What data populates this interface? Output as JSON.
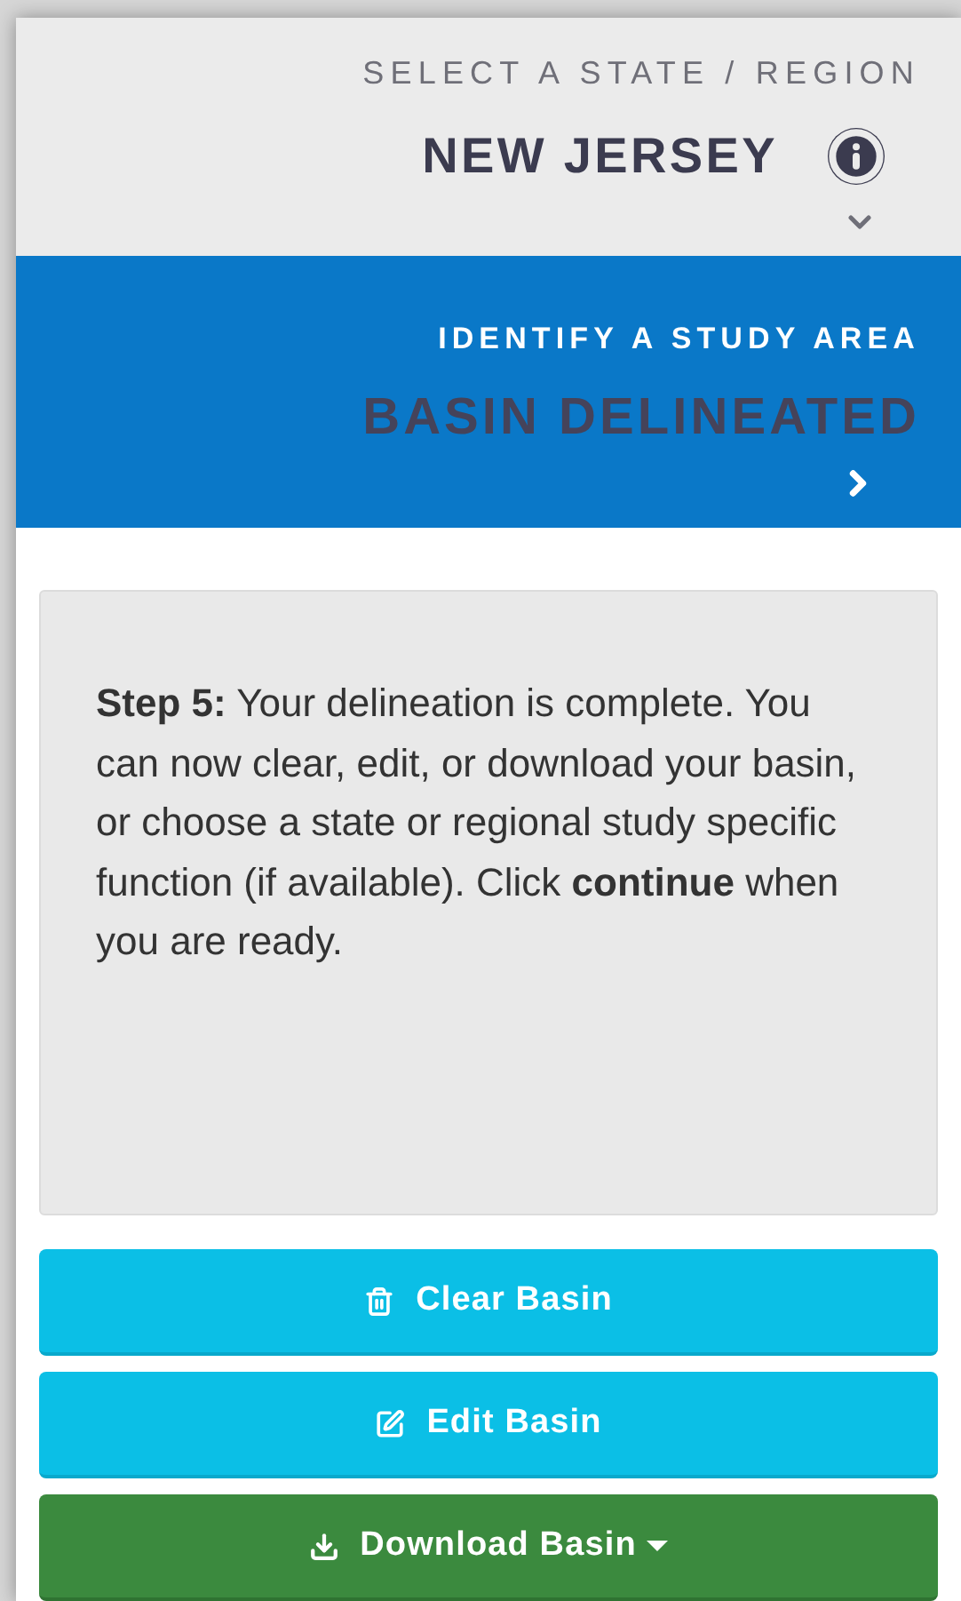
{
  "header": {
    "label": "SELECT A STATE / REGION",
    "state": "NEW JERSEY"
  },
  "step_banner": {
    "label": "IDENTIFY A STUDY AREA",
    "status": "BASIN DELINEATED"
  },
  "instructions": "**Step 5:** Your delineation is complete. You can now clear, edit, or download your basin, or choose a state or regional study specific function (if available). Click **continue** when you are ready.",
  "buttons": [
    {
      "label": "Clear Basin",
      "kind": "clear"
    },
    {
      "label": "Edit Basin",
      "kind": "edit"
    },
    {
      "label": "Download Basin",
      "kind": "download"
    }
  ]
}
